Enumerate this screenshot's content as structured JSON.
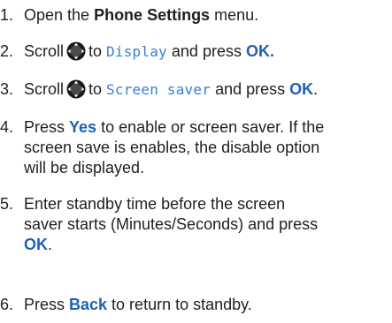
{
  "steps": [
    {
      "number": "1.",
      "pre": "Open the ",
      "bold": "Phone Settings",
      "post": " menu."
    },
    {
      "number": "2.",
      "pre": "Scroll",
      "icon": "navigation-key-icon",
      "to": "to",
      "lcd": "Display",
      "and": "and press",
      "key": "OK."
    },
    {
      "number": "3.",
      "pre": "Scroll",
      "icon": "navigation-key-icon",
      "to": "to",
      "lcd": "Screen saver",
      "and": "and press",
      "key": "OK",
      "end": "."
    },
    {
      "number": "4.",
      "pre": "Press ",
      "key": "Yes",
      "line1_rest": " to enable or screen saver. If the",
      "line2": "screen save is enables, the disable option",
      "line3": "will be displayed."
    },
    {
      "number": "5.",
      "line1": "Enter standby time before the screen",
      "line2": "saver starts (Minutes/Seconds) and press",
      "key": "OK",
      "end": "."
    },
    {
      "number": "6.",
      "pre": "Press ",
      "key": "Back",
      "post": " to return to standby."
    }
  ],
  "colors": {
    "text": "#1f1f1f",
    "key_highlight": "#1e62b0",
    "lcd_text": "#3a7fd0",
    "nav_key": "#1a1a1a"
  }
}
